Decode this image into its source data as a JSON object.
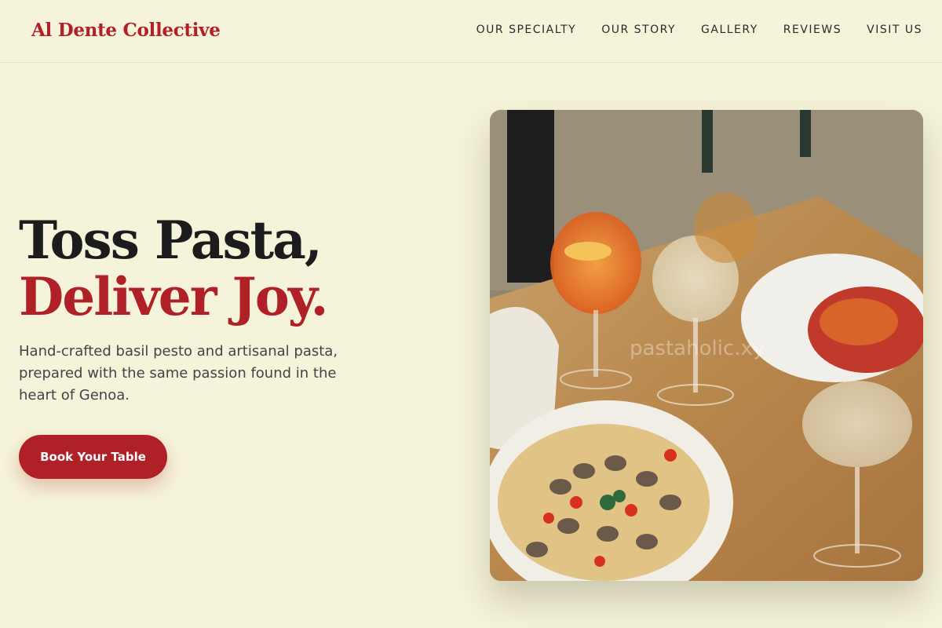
{
  "brand": {
    "name": "Al Dente Collective"
  },
  "nav": {
    "items": [
      "OUR SPECIALTY",
      "OUR STORY",
      "GALLERY",
      "REVIEWS",
      "VISIT US"
    ]
  },
  "hero": {
    "headline_line1": "Toss Pasta,",
    "headline_line2": "Deliver Joy.",
    "subtext": "Hand-crafted basil pesto and artisanal pasta, prepared with the same passion found in the heart of Genoa.",
    "cta_label": "Book Your Table",
    "image_watermark": "pastaholic.xy"
  },
  "colors": {
    "background": "#f5f3d9",
    "accent": "#b02027",
    "text_dark": "#1c1c1c",
    "text_muted": "#3f4548"
  }
}
